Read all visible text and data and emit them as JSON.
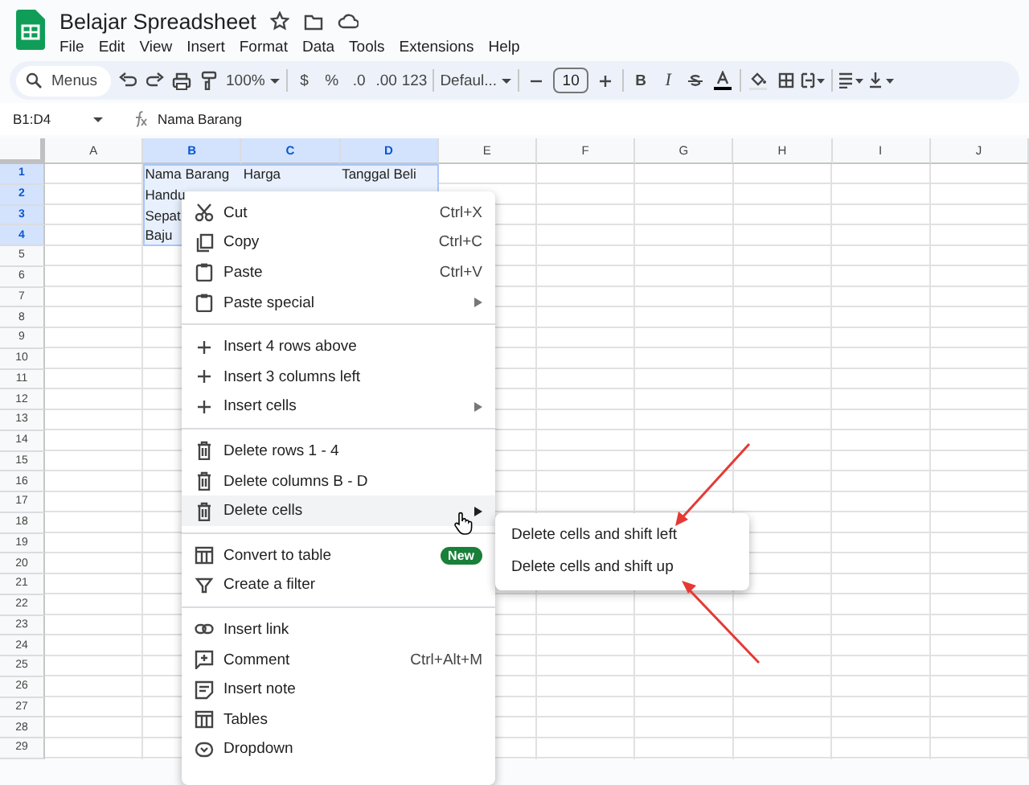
{
  "app": {
    "title": "Belajar Spreadsheet",
    "menus": [
      "File",
      "Edit",
      "View",
      "Insert",
      "Format",
      "Data",
      "Tools",
      "Extensions",
      "Help"
    ]
  },
  "toolbar": {
    "search_placeholder": "Menus",
    "zoom": "100%",
    "currency": "$",
    "percent": "%",
    "decimal_less": ".0",
    "decimal_more": ".00",
    "number_format": "123",
    "font": "Defaul...",
    "font_size": "10",
    "bold": "B",
    "italic": "I"
  },
  "formula_bar": {
    "name_box": "B1:D4",
    "formula": "Nama Barang"
  },
  "columns": [
    {
      "label": "A",
      "selected": false
    },
    {
      "label": "B",
      "selected": true
    },
    {
      "label": "C",
      "selected": true
    },
    {
      "label": "D",
      "selected": true
    },
    {
      "label": "E",
      "selected": false
    },
    {
      "label": "F",
      "selected": false
    },
    {
      "label": "G",
      "selected": false
    },
    {
      "label": "H",
      "selected": false
    },
    {
      "label": "I",
      "selected": false
    },
    {
      "label": "J",
      "selected": false
    }
  ],
  "rows": [
    {
      "number": "1",
      "selected": true,
      "cells_from_b": [
        "Nama Barang",
        "Harga",
        "Tanggal Beli"
      ]
    },
    {
      "number": "2",
      "selected": true,
      "cells_from_b": [
        "Handu"
      ]
    },
    {
      "number": "3",
      "selected": true,
      "cells_from_b": [
        "Sepat"
      ]
    },
    {
      "number": "4",
      "selected": true,
      "cells_from_b": [
        "Baju"
      ]
    },
    {
      "number": "5",
      "selected": false
    },
    {
      "number": "6",
      "selected": false
    },
    {
      "number": "7",
      "selected": false
    },
    {
      "number": "8",
      "selected": false
    },
    {
      "number": "9",
      "selected": false
    },
    {
      "number": "10",
      "selected": false
    },
    {
      "number": "11",
      "selected": false
    },
    {
      "number": "12",
      "selected": false
    },
    {
      "number": "13",
      "selected": false
    },
    {
      "number": "14",
      "selected": false
    },
    {
      "number": "15",
      "selected": false
    },
    {
      "number": "16",
      "selected": false
    },
    {
      "number": "17",
      "selected": false
    },
    {
      "number": "18",
      "selected": false
    },
    {
      "number": "19",
      "selected": false
    },
    {
      "number": "20",
      "selected": false
    },
    {
      "number": "21",
      "selected": false
    },
    {
      "number": "22",
      "selected": false
    },
    {
      "number": "23",
      "selected": false
    },
    {
      "number": "24",
      "selected": false
    },
    {
      "number": "25",
      "selected": false
    },
    {
      "number": "26",
      "selected": false
    },
    {
      "number": "27",
      "selected": false
    },
    {
      "number": "28",
      "selected": false
    },
    {
      "number": "29",
      "selected": false
    }
  ],
  "context_menu": {
    "sections": [
      [
        {
          "label": "Cut",
          "shortcut": "Ctrl+X",
          "submenu": false,
          "highlighted": false
        },
        {
          "label": "Copy",
          "shortcut": "Ctrl+C",
          "submenu": false,
          "highlighted": false
        },
        {
          "label": "Paste",
          "shortcut": "Ctrl+V",
          "submenu": false,
          "highlighted": false
        },
        {
          "label": "Paste special",
          "submenu": true,
          "highlighted": false
        }
      ],
      [
        {
          "label": "Insert 4 rows above",
          "submenu": false,
          "highlighted": false
        },
        {
          "label": "Insert 3 columns left",
          "submenu": false,
          "highlighted": false
        },
        {
          "label": "Insert cells",
          "submenu": true,
          "highlighted": false
        }
      ],
      [
        {
          "label": "Delete rows 1 - 4",
          "submenu": false,
          "highlighted": false
        },
        {
          "label": "Delete columns B - D",
          "submenu": false,
          "highlighted": false
        },
        {
          "label": "Delete cells",
          "submenu": true,
          "highlighted": true
        }
      ],
      [
        {
          "label": "Convert to table",
          "badge": "New",
          "submenu": false,
          "highlighted": false
        },
        {
          "label": "Create a filter",
          "submenu": false,
          "highlighted": false
        }
      ],
      [
        {
          "label": "Insert link",
          "submenu": false,
          "highlighted": false
        },
        {
          "label": "Comment",
          "shortcut": "Ctrl+Alt+M",
          "submenu": false,
          "highlighted": false
        },
        {
          "label": "Insert note",
          "submenu": false,
          "highlighted": false
        },
        {
          "label": "Tables",
          "submenu": false,
          "highlighted": false
        },
        {
          "label": "Dropdown",
          "submenu": false,
          "highlighted": false
        }
      ]
    ]
  },
  "submenu": {
    "items": [
      {
        "label": "Delete cells and shift left"
      },
      {
        "label": "Delete cells and shift up"
      }
    ]
  }
}
